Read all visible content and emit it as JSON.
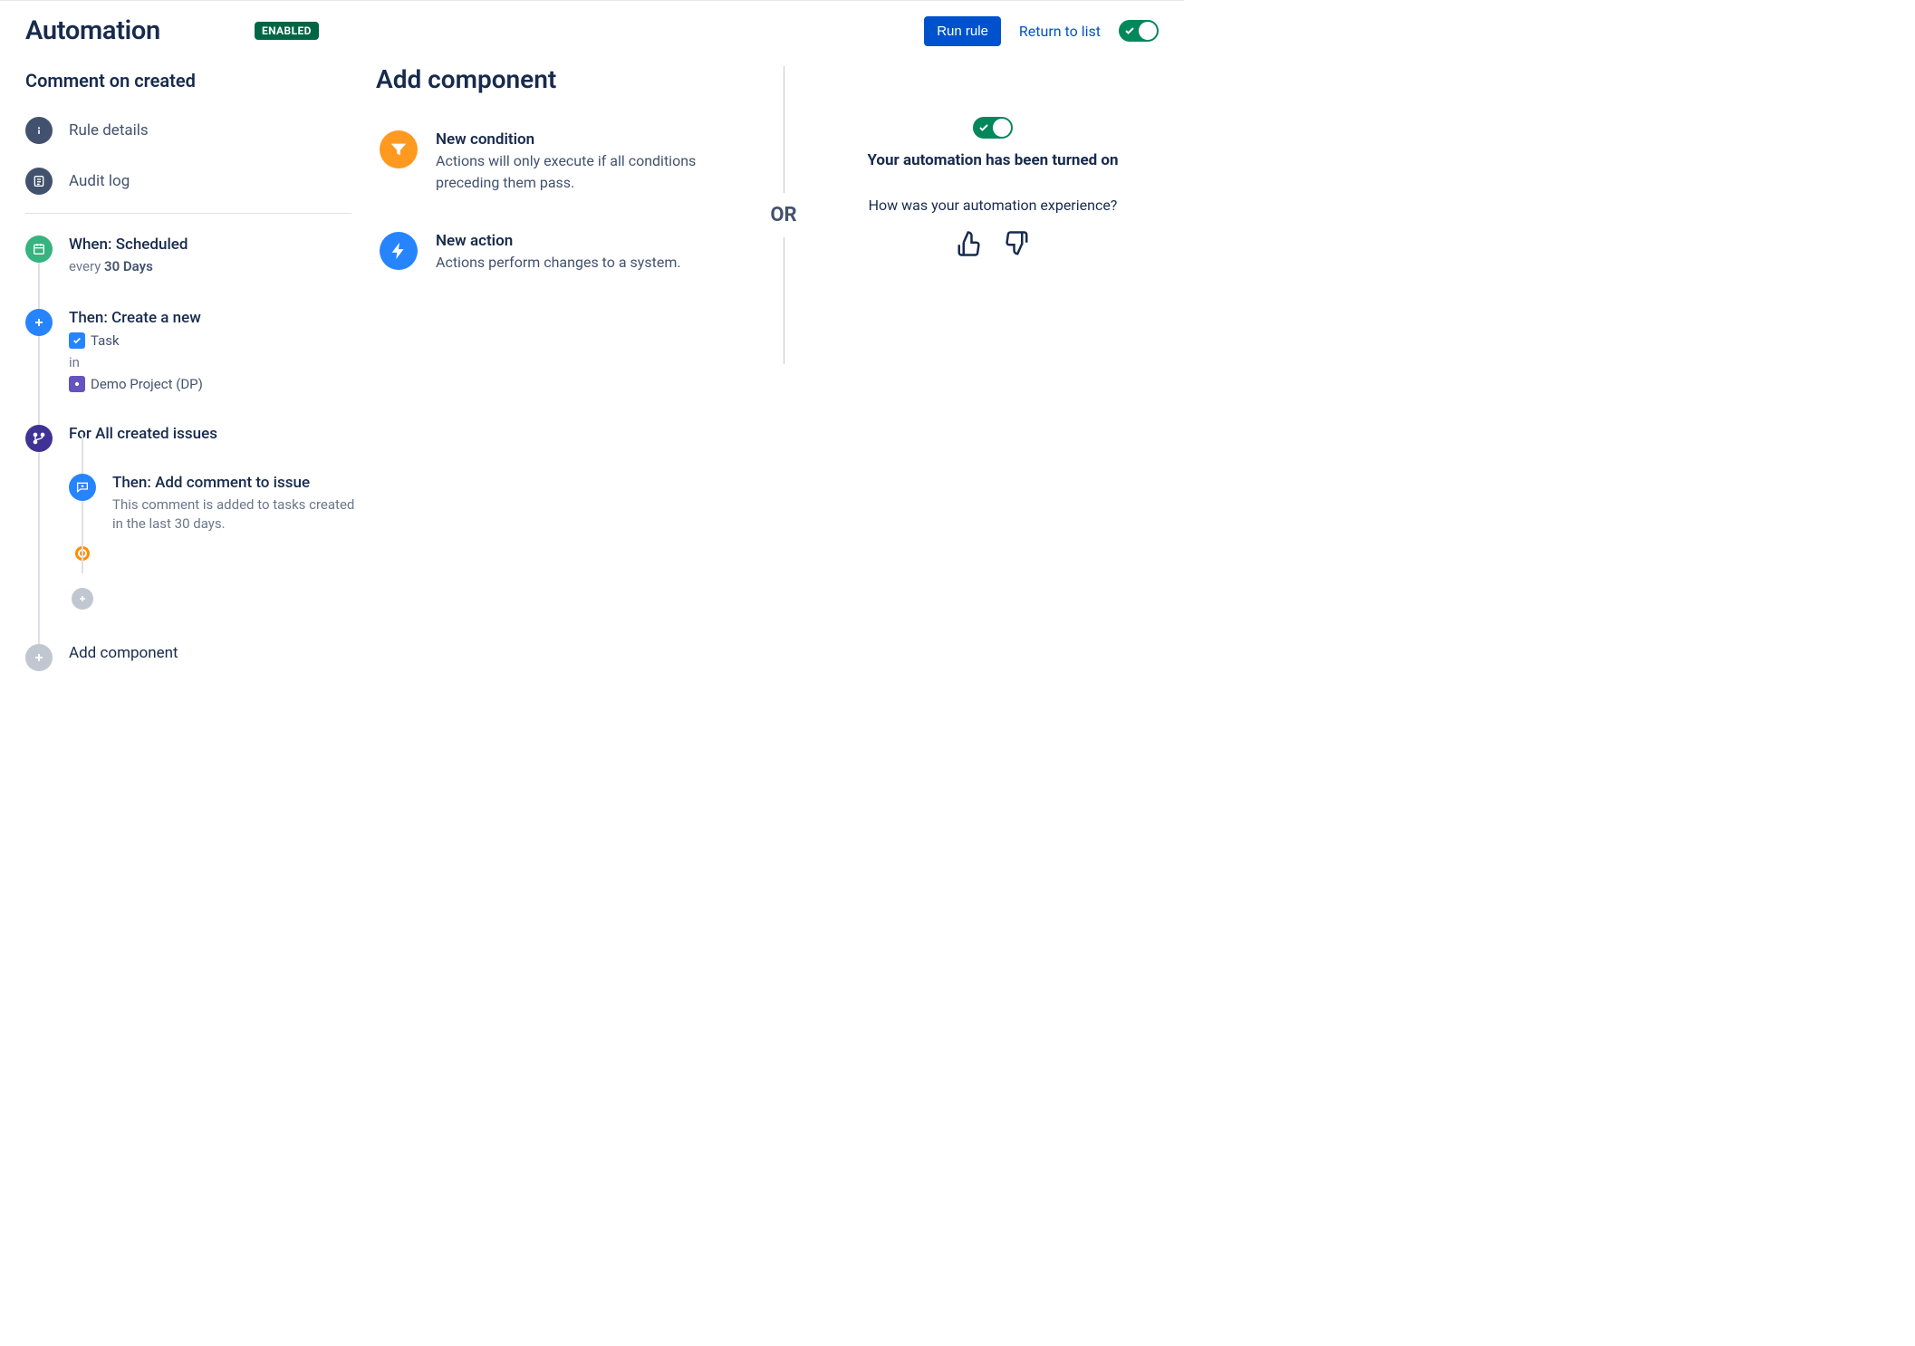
{
  "header": {
    "title": "Automation",
    "status_badge": "ENABLED",
    "run_rule_button": "Run rule",
    "return_link": "Return to list"
  },
  "sidebar": {
    "rule_name": "Comment on created",
    "nav": {
      "details": "Rule details",
      "audit_log": "Audit log"
    }
  },
  "tree": {
    "trigger": {
      "title": "When: Scheduled",
      "sub_prefix": "every ",
      "sub_bold": "30 Days"
    },
    "action1": {
      "title": "Then: Create a new",
      "task_label": "Task",
      "in_label": "in",
      "project_label": "Demo Project (DP)"
    },
    "branch": {
      "title": "For All created issues"
    },
    "action2": {
      "title": "Then: Add comment to issue",
      "sub": "This comment is added to tasks created in the last 30 days."
    },
    "add_component": "Add component"
  },
  "middle": {
    "title": "Add component",
    "condition": {
      "title": "New condition",
      "desc": "Actions will only execute if all conditions preceding them pass."
    },
    "action": {
      "title": "New action",
      "desc": "Actions perform changes to a system."
    }
  },
  "or_label": "OR",
  "right": {
    "turned_on": "Your automation has been turned on",
    "question": "How was your automation experience?"
  }
}
